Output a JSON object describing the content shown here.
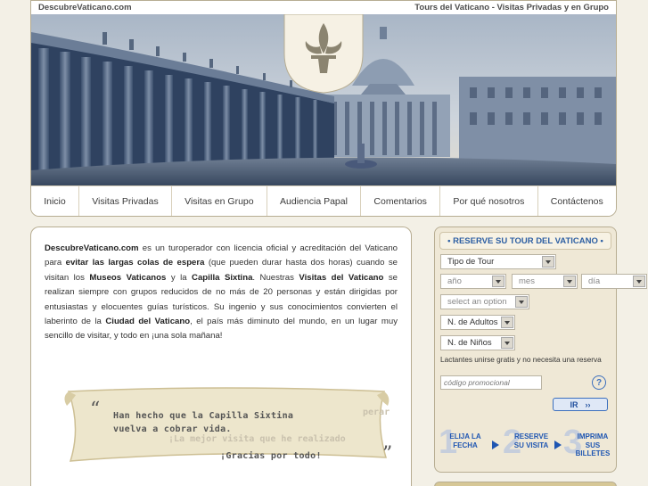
{
  "header": {
    "site_name": "DescubreVaticano.com",
    "tagline": "Tours del Vaticano - Visitas Privadas y en Grupo"
  },
  "nav": {
    "items": [
      {
        "label": "Inicio"
      },
      {
        "label": "Visitas Privadas"
      },
      {
        "label": "Visitas en Grupo"
      },
      {
        "label": "Audiencia Papal"
      },
      {
        "label": "Comentarios"
      },
      {
        "label": "Por qué nosotros"
      },
      {
        "label": "Contáctenos"
      }
    ]
  },
  "intro": {
    "p1": "DescubreVaticano.com",
    "p2": " es un turoperador con licencia oficial y acreditación del Vaticano para ",
    "p3": "evitar las largas colas de espera",
    "p4": " (que pueden durar hasta dos horas) cuando se visitan los ",
    "p5": "Museos Vaticanos",
    "p6": " y la ",
    "p7": "Capilla Sixtina",
    "p8": ". Nuestras ",
    "p9": "Visitas del Vaticano",
    "p10": " se realizan siempre con grupos reducidos de no más de 20 personas y están dirigidas por entusiastas y elocuentes guías turísticos. Su ingenio y sus conocimientos convierten el laberinto de la ",
    "p11": "Ciudad del Vaticano",
    "p12": ", el país más diminuto del mundo, en un lugar muy sencillo de visitar, y todo en ¡una sola mañana!"
  },
  "quote": {
    "line1": "Han hecho que la Capilla Sixtina",
    "line2": "vuelva a cobrar vida.",
    "line3": "¡Gracias por todo!",
    "ghost1": "perar",
    "ghost2": "¡La mejor visita que he realizado"
  },
  "booking": {
    "title": "• RESERVE SU TOUR DEL VATICANO •",
    "tour_type": "Tipo de Tour",
    "year": "año",
    "month": "mes",
    "day": "día",
    "option": "select an option",
    "adults": "N. de Adultos",
    "children": "N. de Niños",
    "infants_note": "Lactantes  unirse gratis y no necesita una reserva",
    "promo_placeholder": "código promocional",
    "help_label": "?",
    "go_label": "IR",
    "step1_num": "1",
    "step1": "ELIJA LA FECHA",
    "step2_num": "2",
    "step2": "RESERVE SU VISITA",
    "step3_num": "3",
    "step3": "IMPRIMA SUS BILLETES"
  },
  "colors": {
    "accent_blue": "#1f56b2",
    "background": "#f3f0e6",
    "border": "#b7ad92"
  }
}
